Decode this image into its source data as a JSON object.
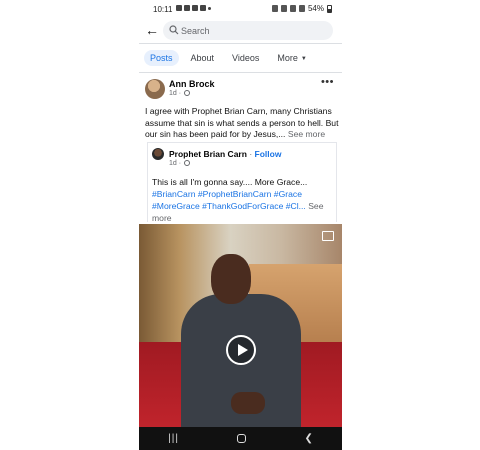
{
  "status_bar": {
    "time": "10:11",
    "battery": "54%"
  },
  "search": {
    "placeholder": "Search"
  },
  "tabs": [
    {
      "label": "Posts",
      "active": true
    },
    {
      "label": "About",
      "active": false
    },
    {
      "label": "Videos",
      "active": false
    },
    {
      "label": "More",
      "active": false
    }
  ],
  "post": {
    "author": "Ann Brock",
    "time": "1d",
    "text": "I agree with Prophet Brian Carn, many Christians assume that sin is what sends a person to hell. But our sin has been paid for by Jesus,...",
    "see_more": "See more"
  },
  "shared_post": {
    "author": "Prophet Brian Carn",
    "separator": "·",
    "follow": "Follow",
    "time": "1d",
    "text": "This is all I'm gonna say.... More Grace...",
    "hashtags": "#BrianCarn #ProphetBrianCarn #Grace #MoreGrace #ThankGodForGrace #Cl...",
    "see_more": "See more"
  },
  "colors": {
    "accent": "#1b74e4",
    "tab_active_bg": "#e7f0fd",
    "secondary_text": "#65676b"
  }
}
